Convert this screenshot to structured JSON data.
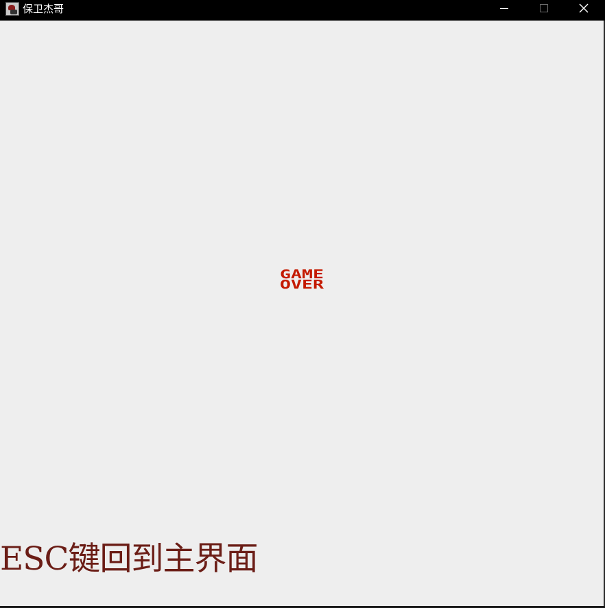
{
  "window": {
    "title": "保卫杰哥"
  },
  "controls": {
    "minimize_icon": "minimize-icon",
    "maximize_icon": "maximize-icon",
    "close_icon": "close-icon"
  },
  "game": {
    "gameover_line1": "GAME",
    "gameover_line2": "OVER",
    "gameover_color": "#c41a00",
    "hint": "ESC键回到主界面",
    "hint_color": "#6b1d16",
    "background": "#eeeeee"
  }
}
